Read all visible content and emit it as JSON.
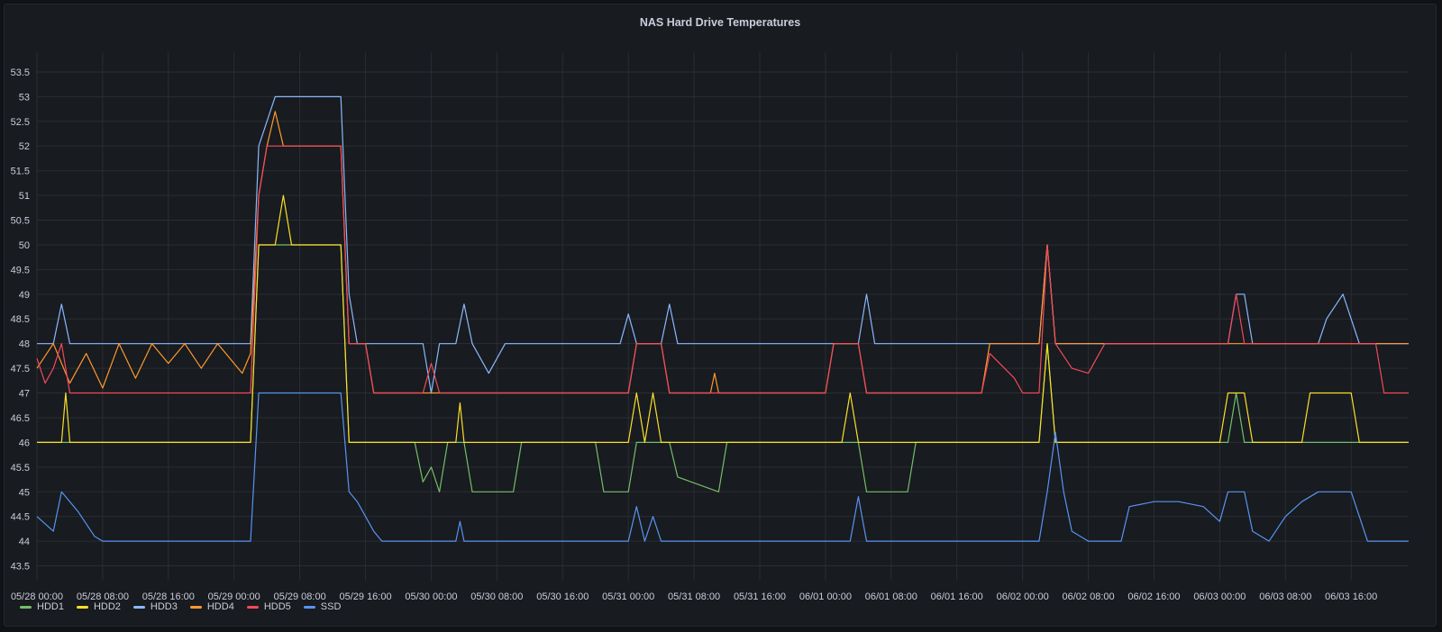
{
  "panel": {
    "title": "NAS Hard Drive Temperatures"
  },
  "chart_data": {
    "type": "line",
    "title": "NAS Hard Drive Temperatures",
    "xlabel": "",
    "ylabel": "",
    "x_range": [
      "05/28 00:00",
      "06/03 23:00"
    ],
    "ylim": [
      43.2,
      53.9
    ],
    "y_ticks": [
      43.5,
      44,
      44.5,
      45,
      45.5,
      46,
      46.5,
      47,
      47.5,
      48,
      48.5,
      49,
      49.5,
      50,
      50.5,
      51,
      51.5,
      52,
      52.5,
      53,
      53.5
    ],
    "x_ticks": [
      "05/28 00:00",
      "05/28 08:00",
      "05/28 16:00",
      "05/29 00:00",
      "05/29 08:00",
      "05/29 16:00",
      "05/30 00:00",
      "05/30 08:00",
      "05/30 16:00",
      "05/31 00:00",
      "05/31 08:00",
      "05/31 16:00",
      "06/01 00:00",
      "06/01 08:00",
      "06/01 16:00",
      "06/02 00:00",
      "06/02 08:00",
      "06/02 16:00",
      "06/03 00:00",
      "06/03 08:00",
      "06/03 16:00"
    ],
    "grid": true,
    "legend_position": "bottom-left",
    "series": [
      {
        "name": "HDD1",
        "color": "#73bf69",
        "points": [
          [
            "05/28 00:00",
            46
          ],
          [
            "05/29 02:00",
            46
          ],
          [
            "05/29 03:00",
            50
          ],
          [
            "05/29 13:00",
            50
          ],
          [
            "05/29 14:00",
            46
          ],
          [
            "05/29 22:00",
            46
          ],
          [
            "05/29 23:00",
            45.2
          ],
          [
            "05/30 00:00",
            45.5
          ],
          [
            "05/30 01:00",
            45
          ],
          [
            "05/30 02:00",
            46
          ],
          [
            "05/30 04:00",
            46
          ],
          [
            "05/30 05:00",
            45
          ],
          [
            "05/30 10:00",
            45
          ],
          [
            "05/30 11:00",
            46
          ],
          [
            "05/30 20:00",
            46
          ],
          [
            "05/30 21:00",
            45
          ],
          [
            "05/31 00:00",
            45
          ],
          [
            "05/31 01:00",
            46
          ],
          [
            "05/31 05:00",
            46
          ],
          [
            "05/31 06:00",
            45.3
          ],
          [
            "05/31 11:00",
            45
          ],
          [
            "05/31 12:00",
            46
          ],
          [
            "06/01 04:00",
            46
          ],
          [
            "06/01 05:00",
            45
          ],
          [
            "06/01 10:00",
            45
          ],
          [
            "06/01 11:00",
            46
          ],
          [
            "06/02 02:00",
            46
          ],
          [
            "06/02 03:00",
            48
          ],
          [
            "06/02 04:00",
            46
          ],
          [
            "06/03 01:00",
            46
          ],
          [
            "06/03 02:00",
            47
          ],
          [
            "06/03 03:00",
            46
          ],
          [
            "06/03 23:00",
            46
          ]
        ]
      },
      {
        "name": "HDD2",
        "color": "#fade2a",
        "points": [
          [
            "05/28 00:00",
            46
          ],
          [
            "05/28 03:00",
            46
          ],
          [
            "05/28 03:30",
            47
          ],
          [
            "05/28 04:00",
            46
          ],
          [
            "05/29 02:00",
            46
          ],
          [
            "05/29 03:00",
            50
          ],
          [
            "05/29 05:00",
            50
          ],
          [
            "05/29 06:00",
            51
          ],
          [
            "05/29 07:00",
            50
          ],
          [
            "05/29 13:00",
            50
          ],
          [
            "05/29 14:00",
            46
          ],
          [
            "05/30 03:00",
            46
          ],
          [
            "05/30 03:30",
            46.8
          ],
          [
            "05/30 04:00",
            46
          ],
          [
            "05/31 00:00",
            46
          ],
          [
            "05/31 01:00",
            47
          ],
          [
            "05/31 02:00",
            46
          ],
          [
            "05/31 03:00",
            47
          ],
          [
            "05/31 04:00",
            46
          ],
          [
            "06/01 02:00",
            46
          ],
          [
            "06/01 03:00",
            47
          ],
          [
            "06/01 04:00",
            46
          ],
          [
            "06/02 02:00",
            46
          ],
          [
            "06/02 03:00",
            48
          ],
          [
            "06/02 04:00",
            46
          ],
          [
            "06/03 00:00",
            46
          ],
          [
            "06/03 01:00",
            47
          ],
          [
            "06/03 03:00",
            47
          ],
          [
            "06/03 04:00",
            46
          ],
          [
            "06/03 10:00",
            46
          ],
          [
            "06/03 11:00",
            47
          ],
          [
            "06/03 16:00",
            47
          ],
          [
            "06/03 17:00",
            46
          ],
          [
            "06/03 23:00",
            46
          ]
        ]
      },
      {
        "name": "HDD3",
        "color": "#8ab8ff",
        "points": [
          [
            "05/28 00:00",
            48
          ],
          [
            "05/28 02:00",
            48
          ],
          [
            "05/28 03:00",
            48.8
          ],
          [
            "05/28 04:00",
            48
          ],
          [
            "05/29 02:00",
            48
          ],
          [
            "05/29 03:00",
            52
          ],
          [
            "05/29 04:00",
            52.5
          ],
          [
            "05/29 05:00",
            53
          ],
          [
            "05/29 13:00",
            53
          ],
          [
            "05/29 14:00",
            49
          ],
          [
            "05/29 15:00",
            48
          ],
          [
            "05/29 23:00",
            48
          ],
          [
            "05/30 00:00",
            47
          ],
          [
            "05/30 01:00",
            48
          ],
          [
            "05/30 03:00",
            48
          ],
          [
            "05/30 04:00",
            48.8
          ],
          [
            "05/30 05:00",
            48
          ],
          [
            "05/30 07:00",
            47.4
          ],
          [
            "05/30 09:00",
            48
          ],
          [
            "05/30 23:00",
            48
          ],
          [
            "05/31 00:00",
            48.6
          ],
          [
            "05/31 01:00",
            48
          ],
          [
            "05/31 04:00",
            48
          ],
          [
            "05/31 05:00",
            48.8
          ],
          [
            "05/31 06:00",
            48
          ],
          [
            "06/01 04:00",
            48
          ],
          [
            "06/01 05:00",
            49
          ],
          [
            "06/01 06:00",
            48
          ],
          [
            "06/02 02:00",
            48
          ],
          [
            "06/02 03:00",
            50
          ],
          [
            "06/02 04:00",
            48
          ],
          [
            "06/03 01:00",
            48
          ],
          [
            "06/03 02:00",
            49
          ],
          [
            "06/03 03:00",
            49
          ],
          [
            "06/03 04:00",
            48
          ],
          [
            "06/03 12:00",
            48
          ],
          [
            "06/03 13:00",
            48.5
          ],
          [
            "06/03 15:00",
            49
          ],
          [
            "06/03 16:00",
            48.5
          ],
          [
            "06/03 17:00",
            48
          ],
          [
            "06/03 23:00",
            48
          ]
        ]
      },
      {
        "name": "HDD4",
        "color": "#ff9830",
        "points": [
          [
            "05/28 00:00",
            47.5
          ],
          [
            "05/28 02:00",
            48
          ],
          [
            "05/28 04:00",
            47.2
          ],
          [
            "05/28 06:00",
            47.8
          ],
          [
            "05/28 08:00",
            47.1
          ],
          [
            "05/28 10:00",
            48
          ],
          [
            "05/28 12:00",
            47.3
          ],
          [
            "05/28 14:00",
            48
          ],
          [
            "05/28 16:00",
            47.6
          ],
          [
            "05/28 18:00",
            48
          ],
          [
            "05/28 20:00",
            47.5
          ],
          [
            "05/28 22:00",
            48
          ],
          [
            "05/29 01:00",
            47.4
          ],
          [
            "05/29 02:00",
            47.8
          ],
          [
            "05/29 03:00",
            51
          ],
          [
            "05/29 04:00",
            52
          ],
          [
            "05/29 05:00",
            52.7
          ],
          [
            "05/29 06:00",
            52
          ],
          [
            "05/29 13:00",
            52
          ],
          [
            "05/29 14:00",
            48
          ],
          [
            "05/29 16:00",
            48
          ],
          [
            "05/29 17:00",
            47
          ],
          [
            "05/31 00:00",
            47
          ],
          [
            "05/31 01:00",
            48
          ],
          [
            "05/31 04:00",
            48
          ],
          [
            "05/31 05:00",
            47
          ],
          [
            "05/31 10:00",
            47
          ],
          [
            "05/31 10:30",
            47.4
          ],
          [
            "05/31 11:00",
            47
          ],
          [
            "06/01 00:00",
            47
          ],
          [
            "06/01 01:00",
            48
          ],
          [
            "06/01 04:00",
            48
          ],
          [
            "06/01 05:00",
            47
          ],
          [
            "06/01 19:00",
            47
          ],
          [
            "06/01 20:00",
            48
          ],
          [
            "06/02 02:00",
            48
          ],
          [
            "06/02 03:00",
            50
          ],
          [
            "06/02 04:00",
            48
          ],
          [
            "06/03 23:00",
            48
          ]
        ]
      },
      {
        "name": "HDD5",
        "color": "#f2495c",
        "points": [
          [
            "05/28 00:00",
            47.7
          ],
          [
            "05/28 01:00",
            47.2
          ],
          [
            "05/28 02:00",
            47.5
          ],
          [
            "05/28 03:00",
            48
          ],
          [
            "05/28 04:00",
            47
          ],
          [
            "05/29 02:00",
            47
          ],
          [
            "05/29 03:00",
            51
          ],
          [
            "05/29 04:00",
            52
          ],
          [
            "05/29 13:00",
            52
          ],
          [
            "05/29 14:00",
            48
          ],
          [
            "05/29 16:00",
            48
          ],
          [
            "05/29 17:00",
            47
          ],
          [
            "05/29 23:00",
            47
          ],
          [
            "05/30 00:00",
            47.6
          ],
          [
            "05/30 01:00",
            47
          ],
          [
            "05/31 00:00",
            47
          ],
          [
            "05/31 01:00",
            48
          ],
          [
            "05/31 04:00",
            48
          ],
          [
            "05/31 05:00",
            47
          ],
          [
            "06/01 00:00",
            47
          ],
          [
            "06/01 01:00",
            48
          ],
          [
            "06/01 04:00",
            48
          ],
          [
            "06/01 05:00",
            47
          ],
          [
            "06/01 19:00",
            47
          ],
          [
            "06/01 20:00",
            47.8
          ],
          [
            "06/01 23:00",
            47.3
          ],
          [
            "06/02 00:00",
            47
          ],
          [
            "06/02 02:00",
            47
          ],
          [
            "06/02 03:00",
            50
          ],
          [
            "06/02 04:00",
            48
          ],
          [
            "06/02 06:00",
            47.5
          ],
          [
            "06/02 08:00",
            47.4
          ],
          [
            "06/02 10:00",
            48
          ],
          [
            "06/03 01:00",
            48
          ],
          [
            "06/03 02:00",
            49
          ],
          [
            "06/03 03:00",
            48
          ],
          [
            "06/03 19:00",
            48
          ],
          [
            "06/03 20:00",
            47
          ],
          [
            "06/03 23:00",
            47
          ]
        ]
      },
      {
        "name": "SSD",
        "color": "#5794f2",
        "points": [
          [
            "05/28 00:00",
            44.5
          ],
          [
            "05/28 02:00",
            44.2
          ],
          [
            "05/28 03:00",
            45
          ],
          [
            "05/28 04:00",
            44.8
          ],
          [
            "05/28 05:00",
            44.6
          ],
          [
            "05/28 07:00",
            44.1
          ],
          [
            "05/28 08:00",
            44
          ],
          [
            "05/29 02:00",
            44
          ],
          [
            "05/29 03:00",
            47
          ],
          [
            "05/29 13:00",
            47
          ],
          [
            "05/29 14:00",
            45
          ],
          [
            "05/29 15:00",
            44.8
          ],
          [
            "05/29 17:00",
            44.2
          ],
          [
            "05/29 18:00",
            44
          ],
          [
            "05/30 03:00",
            44
          ],
          [
            "05/30 03:30",
            44.4
          ],
          [
            "05/30 04:00",
            44
          ],
          [
            "05/31 00:00",
            44
          ],
          [
            "05/31 01:00",
            44.7
          ],
          [
            "05/31 02:00",
            44
          ],
          [
            "05/31 03:00",
            44.5
          ],
          [
            "05/31 04:00",
            44
          ],
          [
            "06/01 03:00",
            44
          ],
          [
            "06/01 04:00",
            44.9
          ],
          [
            "06/01 05:00",
            44
          ],
          [
            "06/02 02:00",
            44
          ],
          [
            "06/02 03:00",
            45
          ],
          [
            "06/02 04:00",
            46.2
          ],
          [
            "06/02 05:00",
            45
          ],
          [
            "06/02 06:00",
            44.2
          ],
          [
            "06/02 08:00",
            44
          ],
          [
            "06/02 12:00",
            44
          ],
          [
            "06/02 13:00",
            44.7
          ],
          [
            "06/02 16:00",
            44.8
          ],
          [
            "06/02 19:00",
            44.8
          ],
          [
            "06/02 22:00",
            44.7
          ],
          [
            "06/03 00:00",
            44.4
          ],
          [
            "06/03 01:00",
            45
          ],
          [
            "06/03 03:00",
            45
          ],
          [
            "06/03 04:00",
            44.2
          ],
          [
            "06/03 06:00",
            44
          ],
          [
            "06/03 08:00",
            44.5
          ],
          [
            "06/03 10:00",
            44.8
          ],
          [
            "06/03 12:00",
            45
          ],
          [
            "06/03 16:00",
            45
          ],
          [
            "06/03 18:00",
            44
          ],
          [
            "06/03 23:00",
            44
          ]
        ]
      }
    ]
  }
}
